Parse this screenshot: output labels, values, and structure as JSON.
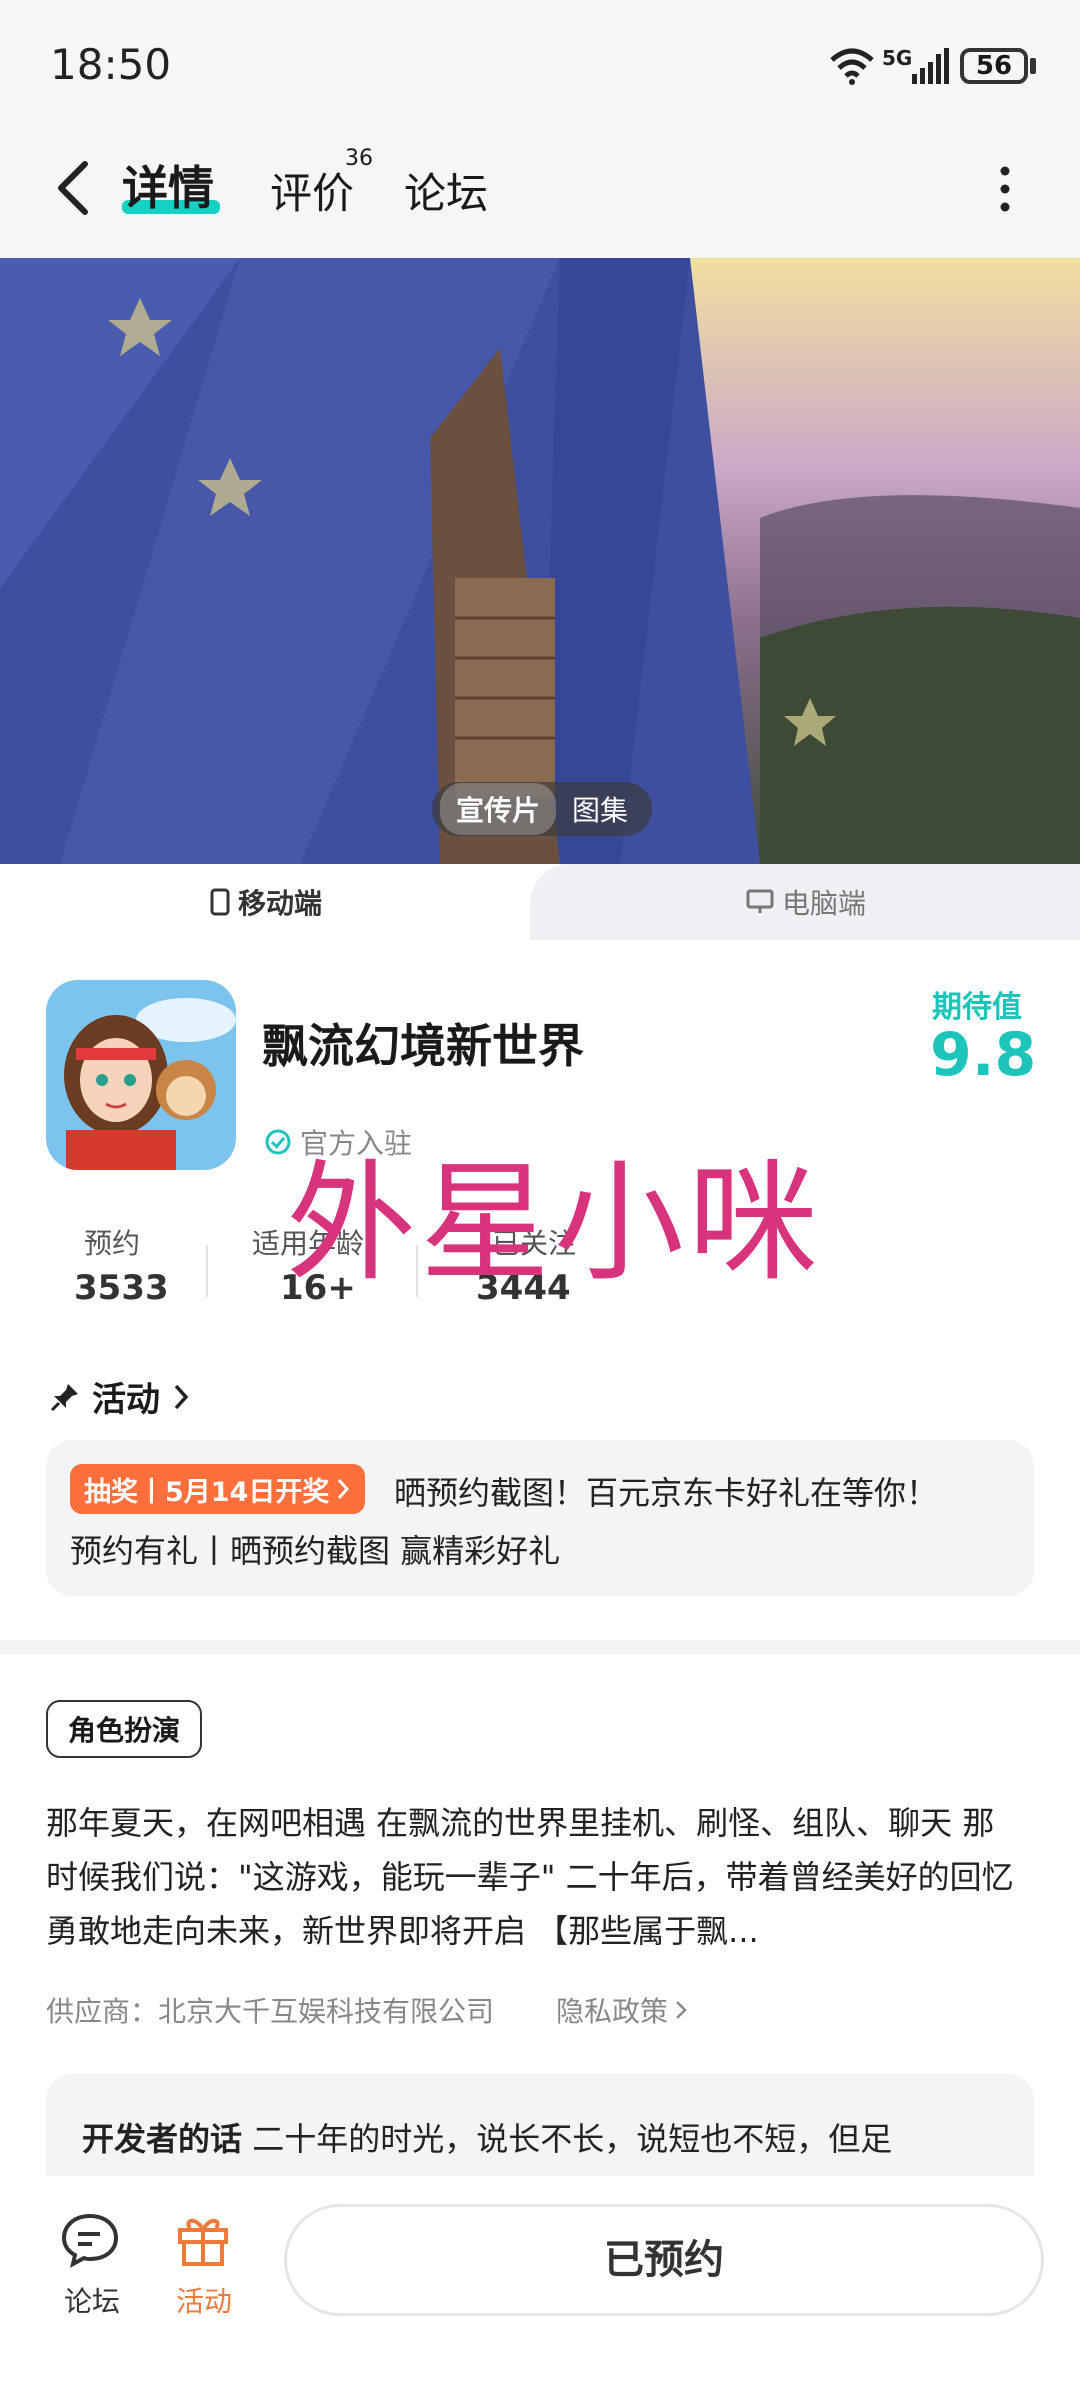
{
  "status_bar": {
    "time": "18:50",
    "network": "5G",
    "battery": "56"
  },
  "header": {
    "tabs": [
      {
        "label": "详情",
        "active": true
      },
      {
        "label": "评价",
        "badge": "36"
      },
      {
        "label": "论坛"
      }
    ]
  },
  "banner": {
    "media_tabs": [
      "宣传片",
      "图集"
    ],
    "active_media": "宣传片"
  },
  "platform_tabs": {
    "mobile": "移动端",
    "pc": "电脑端",
    "active": "移动端"
  },
  "game": {
    "title": "飘流幻境新世界",
    "official_label": "官方入驻",
    "expect_label": "期待值",
    "expect_value": "9.8",
    "stats": [
      {
        "label": "预约",
        "value": "3533"
      },
      {
        "label": "适用年龄",
        "value": "16+"
      },
      {
        "label": "已关注",
        "value": "3444"
      }
    ]
  },
  "watermark": "外星小咪",
  "activity": {
    "title": "活动",
    "badge": "抽奖丨5月14日开奖",
    "line1": "晒预约截图！百元京东卡好礼在等你！",
    "line2": "预约有礼丨晒预约截图 赢精彩好礼"
  },
  "description": {
    "genre": "角色扮演",
    "text": "那年夏天，在网吧相遇 在飘流的世界里挂机、刷怪、组队、聊天 那时候我们说：\"这游戏，能玩一辈子\" 二十年后，带着曾经美好的回忆 勇敢地走向未来，新世界即将开启 【那些属于飘...",
    "supplier": "供应商：北京大千互娱科技有限公司",
    "privacy": "隐私政策"
  },
  "developer_note": {
    "title": "开发者的话",
    "text": "二十年的时光，说长不长，说短也不短，但足"
  },
  "bottom_nav": {
    "forum": "论坛",
    "activity": "活动",
    "reserve_button": "已预约"
  },
  "colors": {
    "accent": "#16d0c4",
    "orange": "#ff6f3c",
    "watermark": "#d8337d"
  }
}
